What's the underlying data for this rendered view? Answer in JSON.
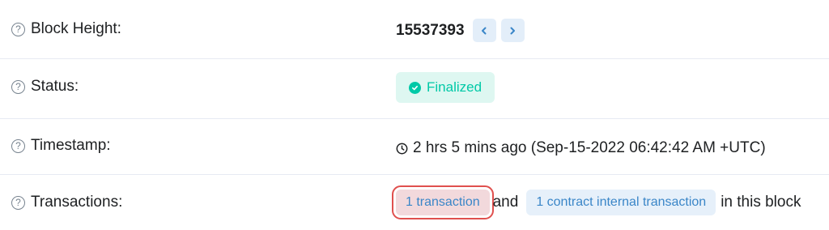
{
  "rows": {
    "block_height": {
      "label": "Block Height:",
      "value": "15537393"
    },
    "status": {
      "label": "Status:",
      "value": "Finalized"
    },
    "timestamp": {
      "label": "Timestamp:",
      "value": "2 hrs 5 mins ago (Sep-15-2022 06:42:42 AM +UTC)"
    },
    "transactions": {
      "label": "Transactions:",
      "tx_link": "1 transaction",
      "joiner": "and",
      "internal_link": "1 contract internal transaction",
      "suffix": "in this block"
    }
  },
  "icons": {
    "help": "question-circle-icon",
    "prev": "chevron-left-icon",
    "next": "chevron-right-icon",
    "status": "check-circle-icon",
    "time": "clock-icon"
  },
  "help_glyph": "?",
  "colors": {
    "accent": "#3a86c8",
    "success": "#00c9a7",
    "success_bg": "#def7f1",
    "highlight_outline": "#e0504e",
    "divider": "#e7eaf3"
  }
}
